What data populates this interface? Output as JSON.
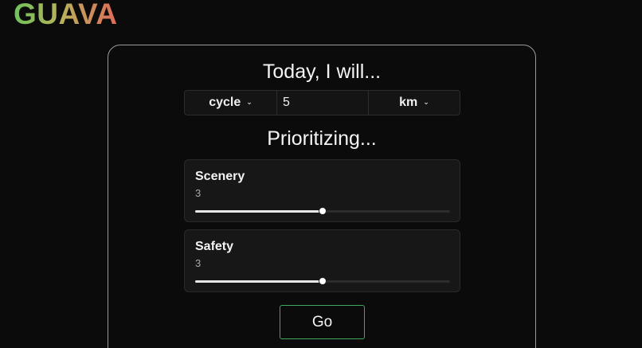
{
  "app": {
    "logo": "GUAVA"
  },
  "planner": {
    "heading": "Today, I will...",
    "activity": "cycle",
    "distance": "5",
    "unit": "km",
    "priorities_heading": "Prioritizing...",
    "priorities": [
      {
        "label": "Scenery",
        "value": "3",
        "level": 0.5
      },
      {
        "label": "Safety",
        "value": "3",
        "level": 0.5
      }
    ],
    "go_label": "Go"
  },
  "colors": {
    "background": "#0b0b0b",
    "go_border": "#3fa85a",
    "logo_gradient": [
      "#6ec35a",
      "#b8b25a",
      "#e06a5a"
    ]
  }
}
